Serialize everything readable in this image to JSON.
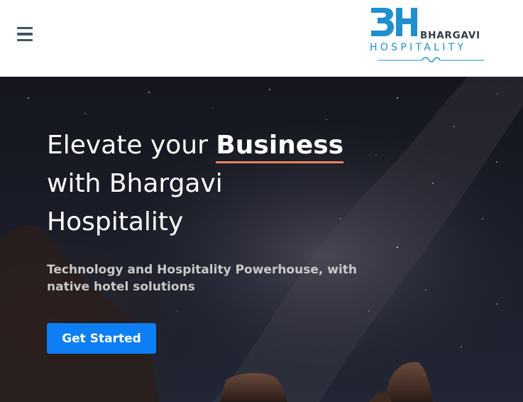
{
  "header": {
    "menu_icon": "hamburger-menu-icon",
    "logo": {
      "monogram": "BH",
      "name_top": "BHARGAVI",
      "name_bottom": "HOSPITALITY",
      "primary_color": "#1f8fcf",
      "text_color": "#2e3b44"
    }
  },
  "hero": {
    "title_part1": "Elevate your ",
    "title_highlight": "Business",
    "title_part2": "with Bhargavi",
    "title_part3": "Hospitality",
    "subtitle": "Technology and Hospitality Powerhouse, with native hotel solutions",
    "cta_label": "Get Started",
    "accent_underline_color": "#e8845a",
    "cta_color": "#0d7ef3",
    "background": "night-sky-milky-way-image"
  }
}
